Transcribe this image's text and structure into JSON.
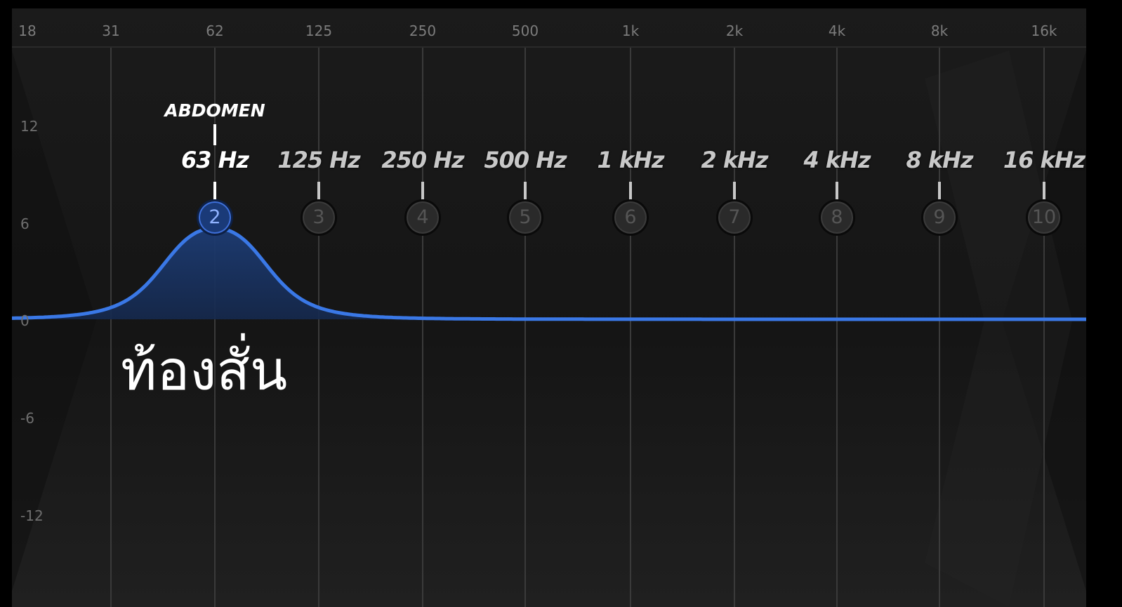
{
  "frequency_axis": [
    "18",
    "31",
    "62",
    "125",
    "250",
    "500",
    "1k",
    "2k",
    "4k",
    "8k",
    "16k"
  ],
  "gain_axis": [
    "12",
    "6",
    "0",
    "-6",
    "-12"
  ],
  "bands": [
    {
      "number": "2",
      "label": "63 Hz",
      "active": true
    },
    {
      "number": "3",
      "label": "125 Hz",
      "active": false
    },
    {
      "number": "4",
      "label": "250 Hz",
      "active": false
    },
    {
      "number": "5",
      "label": "500 Hz",
      "active": false
    },
    {
      "number": "6",
      "label": "1 kHz",
      "active": false
    },
    {
      "number": "7",
      "label": "2 kHz",
      "active": false
    },
    {
      "number": "8",
      "label": "4 kHz",
      "active": false
    },
    {
      "number": "9",
      "label": "8 kHz",
      "active": false
    },
    {
      "number": "10",
      "label": "16 kHz",
      "active": false
    }
  ],
  "active_band": {
    "body_part": "ABDOMEN",
    "gain_db": 6
  },
  "caption": "ท้องสั่น",
  "colors": {
    "curve": "#3a78e6",
    "fill": "#1d3c74",
    "grid": "#3a3a3a"
  }
}
